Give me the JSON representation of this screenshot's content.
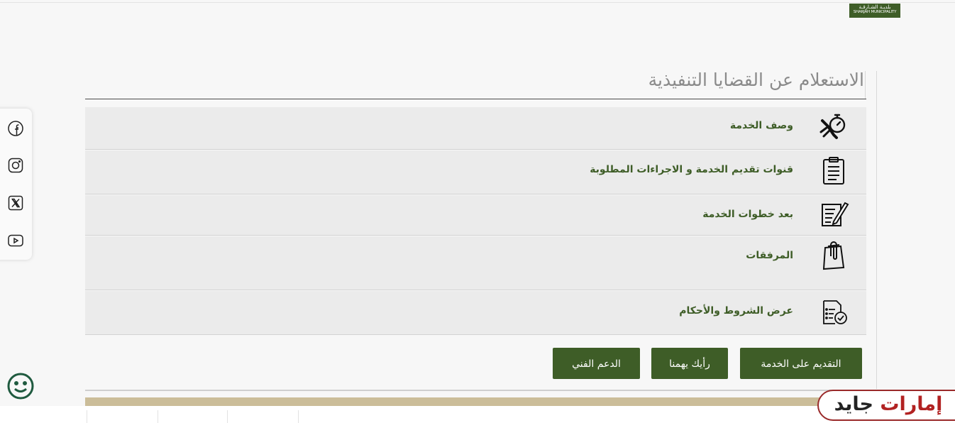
{
  "header": {
    "logo_ar": "بلديـة الشـارقـة",
    "logo_en": "SHARJAH MUNICIPALITY"
  },
  "page": {
    "title": "الاستعلام عن القضايا التنفيذية"
  },
  "accordion": {
    "items": [
      {
        "label": "وصف الخدمة",
        "icon": "tools-stopwatch-icon"
      },
      {
        "label": "قنوات تقديم الخدمة و الاجراءات المطلوبة",
        "icon": "clipboard-icon"
      },
      {
        "label": "بعد خطوات الخدمة",
        "icon": "document-edit-icon"
      },
      {
        "label": "المرفقات",
        "icon": "paperclip-documents-icon"
      },
      {
        "label": "عرض الشروط والأحكام",
        "icon": "checklist-icon"
      }
    ]
  },
  "actions": {
    "apply_label": "التقديم على الخدمة",
    "feedback_label": "رأيك يهمنا",
    "support_label": "الدعم الفني"
  },
  "social": {
    "icons": [
      "facebook-icon",
      "instagram-icon",
      "x-icon",
      "youtube-icon"
    ]
  },
  "watermark": {
    "part1": "إمارات",
    "part2": "جايد"
  },
  "colors": {
    "brand_green": "#3e5d27",
    "tan": "#cbbd99",
    "watermark_red": "#b22222"
  }
}
